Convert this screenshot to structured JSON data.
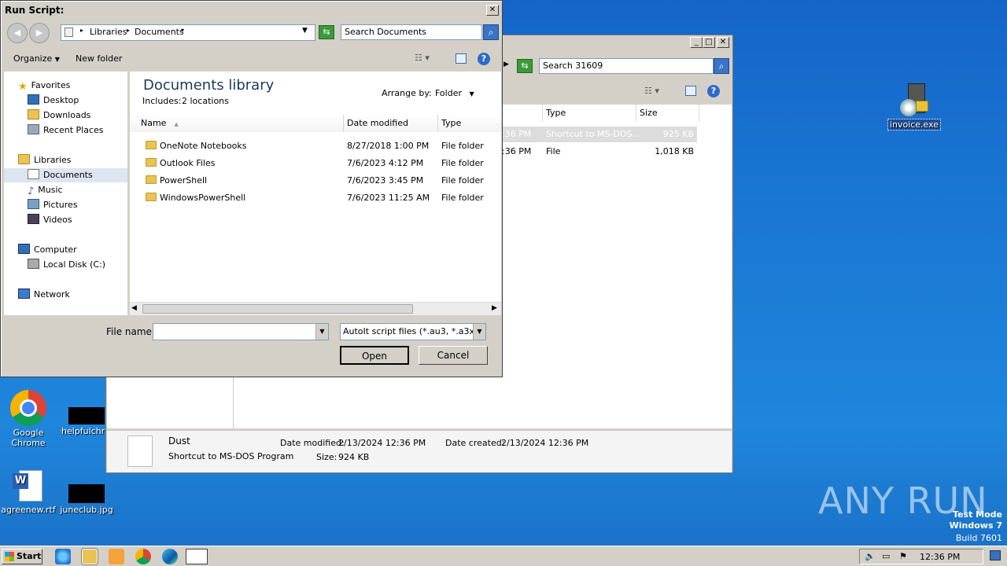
{
  "dialog": {
    "title": "Run Script:",
    "breadcrumb": [
      "Libraries",
      "Documents"
    ],
    "search_placeholder": "Search Documents",
    "toolbar": {
      "organize": "Organize",
      "new_folder": "New folder"
    },
    "library_title": "Documents library",
    "includes": "Includes:",
    "includes_count": "2 locations",
    "arrange_by_label": "Arrange by:",
    "arrange_by_value": "Folder",
    "nav": {
      "favorites": "Favorites",
      "desktop": "Desktop",
      "downloads": "Downloads",
      "recent": "Recent Places",
      "libraries": "Libraries",
      "documents": "Documents",
      "music": "Music",
      "pictures": "Pictures",
      "videos": "Videos",
      "computer": "Computer",
      "local_disk": "Local Disk (C:)",
      "network": "Network"
    },
    "columns": {
      "name": "Name",
      "date_modified": "Date modified",
      "type": "Type"
    },
    "files": [
      {
        "name": "OneNote Notebooks",
        "date": "8/27/2018 1:00 PM",
        "type": "File folder"
      },
      {
        "name": "Outlook Files",
        "date": "7/6/2023 4:12 PM",
        "type": "File folder"
      },
      {
        "name": "PowerShell",
        "date": "7/6/2023 3:45 PM",
        "type": "File folder"
      },
      {
        "name": "WindowsPowerShell",
        "date": "7/6/2023 11:25 AM",
        "type": "File folder"
      }
    ],
    "file_name_label": "File name:",
    "file_name_value": "",
    "file_type": "AutoIt script files (*.au3, *.a3x)",
    "open": "Open",
    "cancel": "Cancel"
  },
  "bg_explorer": {
    "search_placeholder": "Search 31609",
    "columns": {
      "type": "Type",
      "size": "Size"
    },
    "rows": [
      {
        "time": ":36 PM",
        "type": "Shortcut to MS-DOS...",
        "size": "925 KB"
      },
      {
        "time": ":36 PM",
        "type": "File",
        "size": "1,018 KB"
      }
    ],
    "details": {
      "name": "Dust",
      "kind": "Shortcut to MS-DOS Program",
      "date_modified_label": "Date modified:",
      "date_modified": "2/13/2024 12:36 PM",
      "date_created_label": "Date created:",
      "date_created": "2/13/2024 12:36 PM",
      "size_label": "Size:",
      "size": "924 KB"
    }
  },
  "desktop": {
    "icons": {
      "invoice": "invoice.exe",
      "chrome_line1": "Google",
      "chrome_line2": "Chrome",
      "helpful": "helpfulchris",
      "agree": "agreenew.rtf",
      "june": "juneclub.jpg"
    },
    "watermark_logo": "ANY RUN",
    "test_mode": "Test Mode",
    "os": "Windows 7",
    "build": "Build 7601"
  },
  "taskbar": {
    "start": "Start",
    "clock": "12:36 PM"
  }
}
